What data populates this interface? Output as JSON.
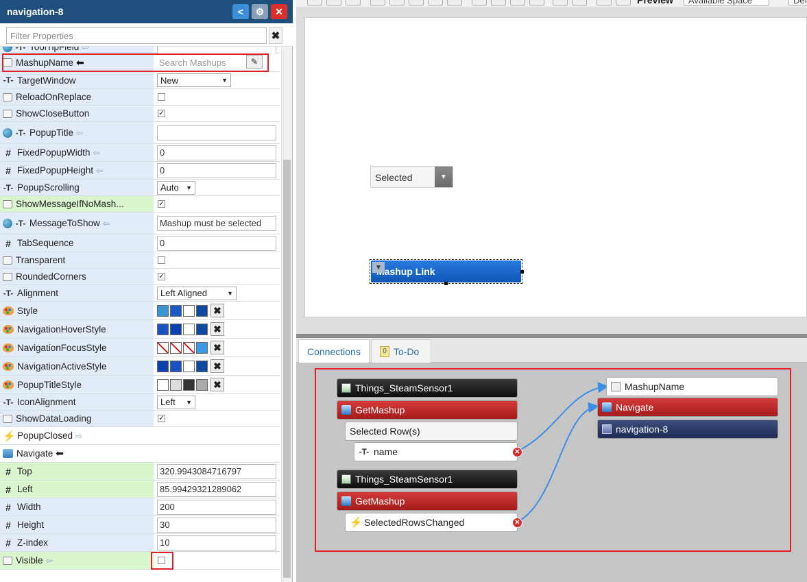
{
  "panel": {
    "title": "navigation-8",
    "filter_placeholder": "Filter Properties"
  },
  "properties": [
    {
      "name": "ToolTipField",
      "icon": "text-icon",
      "globe": true,
      "arrow": "in",
      "type": "text",
      "value": "",
      "bg": "blue"
    },
    {
      "name": "MashupName",
      "icon": "mashup-icon",
      "arrow": "in-solid",
      "type": "search",
      "placeholder": "Search Mashups",
      "bg": "blue",
      "highlight": true
    },
    {
      "name": "TargetWindow",
      "icon": "text-icon",
      "type": "select",
      "value": "New",
      "bg": "blue"
    },
    {
      "name": "ReloadOnReplace",
      "icon": "link-icon",
      "type": "checkbox",
      "checked": false,
      "bg": "blue"
    },
    {
      "name": "ShowCloseButton",
      "icon": "link-icon",
      "type": "checkbox",
      "checked": true,
      "bg": "blue"
    },
    {
      "name": "PopupTitle",
      "icon": "text-icon",
      "globe": true,
      "arrow": "in",
      "type": "text",
      "value": "",
      "bg": "blue"
    },
    {
      "name": "FixedPopupWidth",
      "icon": "hash-icon",
      "arrow": "in",
      "type": "text",
      "value": "0",
      "bg": "blue"
    },
    {
      "name": "FixedPopupHeight",
      "icon": "hash-icon",
      "arrow": "in",
      "type": "text",
      "value": "0",
      "bg": "blue"
    },
    {
      "name": "PopupScrolling",
      "icon": "text-icon",
      "type": "select",
      "value": "Auto",
      "bg": "blue"
    },
    {
      "name": "ShowMessageIfNoMash...",
      "icon": "link-icon",
      "type": "checkbox",
      "checked": true,
      "bg": "green"
    },
    {
      "name": "MessageToShow",
      "icon": "text-icon",
      "globe": true,
      "arrow": "in",
      "type": "text",
      "value": "Mashup must be selected",
      "bg": "blue"
    },
    {
      "name": "TabSequence",
      "icon": "hash-icon",
      "type": "text",
      "value": "0",
      "bg": "blue"
    },
    {
      "name": "Transparent",
      "icon": "link-icon",
      "type": "checkbox",
      "checked": false,
      "bg": "blue"
    },
    {
      "name": "RoundedCorners",
      "icon": "link-icon",
      "type": "checkbox",
      "checked": true,
      "bg": "blue"
    },
    {
      "name": "Alignment",
      "icon": "text-icon",
      "type": "select",
      "value": "Left Aligned",
      "bg": "blue"
    },
    {
      "name": "Style",
      "icon": "palette-icon",
      "type": "style",
      "swatches": [
        "#3a95d6",
        "#1c5ac7",
        "#ffffff",
        "#0d4aa0"
      ],
      "bg": "blue"
    },
    {
      "name": "NavigationHoverStyle",
      "icon": "palette-icon",
      "type": "style",
      "swatches": [
        "#1a52c4",
        "#0c3fb0",
        "#ffffff",
        "#0d4aa0"
      ],
      "bg": "blue"
    },
    {
      "name": "NavigationFocusStyle",
      "icon": "palette-icon",
      "type": "style",
      "swatches": [
        "slash",
        "slash",
        "slash",
        "#3d9be6"
      ],
      "bg": "blue"
    },
    {
      "name": "NavigationActiveStyle",
      "icon": "palette-icon",
      "type": "style",
      "swatches": [
        "#0c3fb0",
        "#1a52c4",
        "#ffffff",
        "#0d4aa0"
      ],
      "bg": "blue"
    },
    {
      "name": "PopupTitleStyle",
      "icon": "palette-icon",
      "type": "style",
      "swatches": [
        "#ffffff",
        "#dddddd",
        "#333333",
        "#aaaaaa"
      ],
      "bg": "blue"
    },
    {
      "name": "IconAlignment",
      "icon": "text-icon",
      "type": "select",
      "value": "Left",
      "bg": "blue"
    },
    {
      "name": "ShowDataLoading",
      "icon": "link-icon",
      "type": "checkbox",
      "checked": true,
      "bg": "blue"
    },
    {
      "name": "PopupClosed",
      "icon": "bolt-icon",
      "arrow": "out",
      "type": "none",
      "bg": "white"
    },
    {
      "name": "Navigate",
      "icon": "service-icon",
      "arrow": "in-solid",
      "type": "none",
      "bg": "white"
    },
    {
      "name": "Top",
      "icon": "hash-icon",
      "type": "text",
      "value": "320.9943084716797",
      "bg": "green"
    },
    {
      "name": "Left",
      "icon": "hash-icon",
      "type": "text",
      "value": "85.99429321289062",
      "bg": "green"
    },
    {
      "name": "Width",
      "icon": "hash-icon",
      "type": "text",
      "value": "200",
      "bg": "blue"
    },
    {
      "name": "Height",
      "icon": "hash-icon",
      "type": "text",
      "value": "30",
      "bg": "blue"
    },
    {
      "name": "Z-index",
      "icon": "hash-icon",
      "type": "text",
      "value": "10",
      "bg": "blue"
    },
    {
      "name": "Visible",
      "icon": "link-icon",
      "arrow": "in",
      "type": "checkbox",
      "checked": false,
      "bg": "green",
      "highlight_value": true
    }
  ],
  "toolbar": {
    "preview_label": "Preview",
    "size_value": "Available Space",
    "extra_value": "Def"
  },
  "canvas": {
    "dropdown_value": "Selected",
    "mashup_link_label": "Mashup Link"
  },
  "tabs": [
    {
      "label": "Connections",
      "active": true
    },
    {
      "label": "To-Do",
      "active": false
    }
  ],
  "connections": {
    "left_group_1": {
      "thing": "Things_SteamSensor1",
      "service": "GetMashup",
      "section": "Selected Row(s)",
      "field": "name"
    },
    "left_group_2": {
      "thing": "Things_SteamSensor1",
      "service": "GetMashup",
      "event": "SelectedRowsChanged"
    },
    "targets": {
      "property": "MashupName",
      "service": "Navigate",
      "widget": "navigation-8"
    }
  },
  "colors": {
    "header": "#1f4f7c",
    "highlight": "#e0202a",
    "wire": "#3b8ee8"
  }
}
